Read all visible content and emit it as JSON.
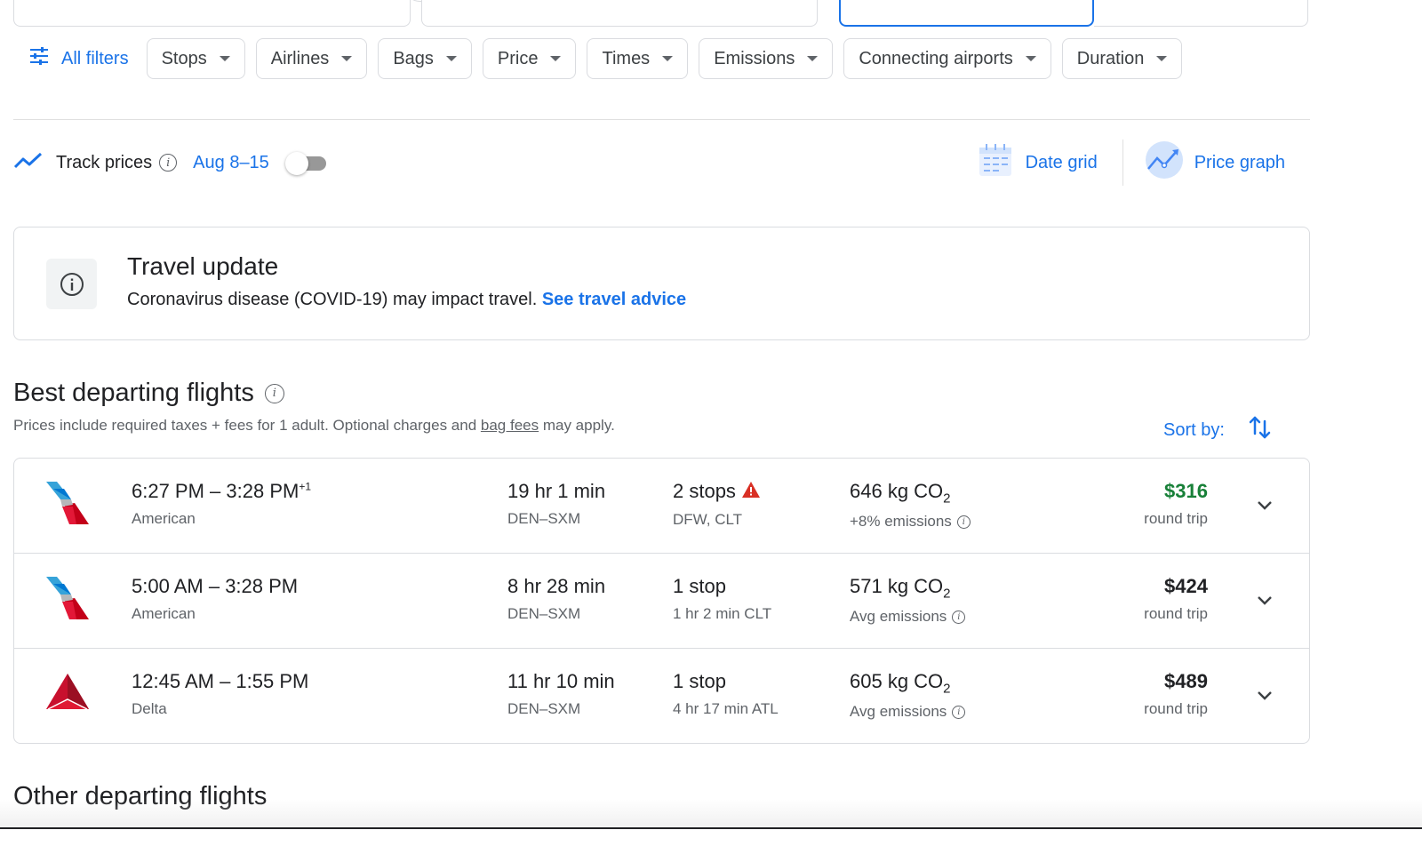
{
  "filters": {
    "all_filters": "All filters",
    "chips": [
      "Stops",
      "Airlines",
      "Bags",
      "Price",
      "Times",
      "Emissions",
      "Connecting airports",
      "Duration"
    ]
  },
  "track": {
    "label": "Track prices",
    "dates": "Aug 8–15",
    "enabled": false,
    "date_grid": "Date grid",
    "price_graph": "Price graph"
  },
  "travel_update": {
    "title": "Travel update",
    "text": "Coronavirus disease (COVID-19) may impact travel.",
    "link": "See travel advice"
  },
  "best": {
    "title": "Best departing flights",
    "sub_before": "Prices include required taxes + fees for 1 adult. Optional charges and ",
    "sub_link": "bag fees",
    "sub_after": " may apply.",
    "sort_label": "Sort by:"
  },
  "flights": [
    {
      "airline": "American",
      "logo": "american-logo",
      "depart": "6:27 PM",
      "arrive": "3:28 PM",
      "day_offset": "+1",
      "duration": "19 hr 1 min",
      "route": "DEN–SXM",
      "stops": "2 stops",
      "stops_detail": "DFW, CLT",
      "warning": true,
      "co2": "646 kg CO",
      "emissions_note": "+8% emissions",
      "price": "$316",
      "price_note": "round trip",
      "price_color": "#188038"
    },
    {
      "airline": "American",
      "logo": "american-logo",
      "depart": "5:00 AM",
      "arrive": "3:28 PM",
      "day_offset": "",
      "duration": "8 hr 28 min",
      "route": "DEN–SXM",
      "stops": "1 stop",
      "stops_detail": "1 hr 2 min CLT",
      "warning": false,
      "co2": "571 kg CO",
      "emissions_note": "Avg emissions",
      "price": "$424",
      "price_note": "round trip",
      "price_color": "#202124"
    },
    {
      "airline": "Delta",
      "logo": "delta-logo",
      "depart": "12:45 AM",
      "arrive": "1:55 PM",
      "day_offset": "",
      "duration": "11 hr 10 min",
      "route": "DEN–SXM",
      "stops": "1 stop",
      "stops_detail": "4 hr 17 min ATL",
      "warning": false,
      "co2": "605 kg CO",
      "emissions_note": "Avg emissions",
      "price": "$489",
      "price_note": "round trip",
      "price_color": "#202124"
    }
  ],
  "other": {
    "title": "Other departing flights"
  },
  "colors": {
    "accent": "#1a73e8",
    "price_best": "#188038",
    "warning": "#d93025",
    "border": "#dadce0"
  }
}
